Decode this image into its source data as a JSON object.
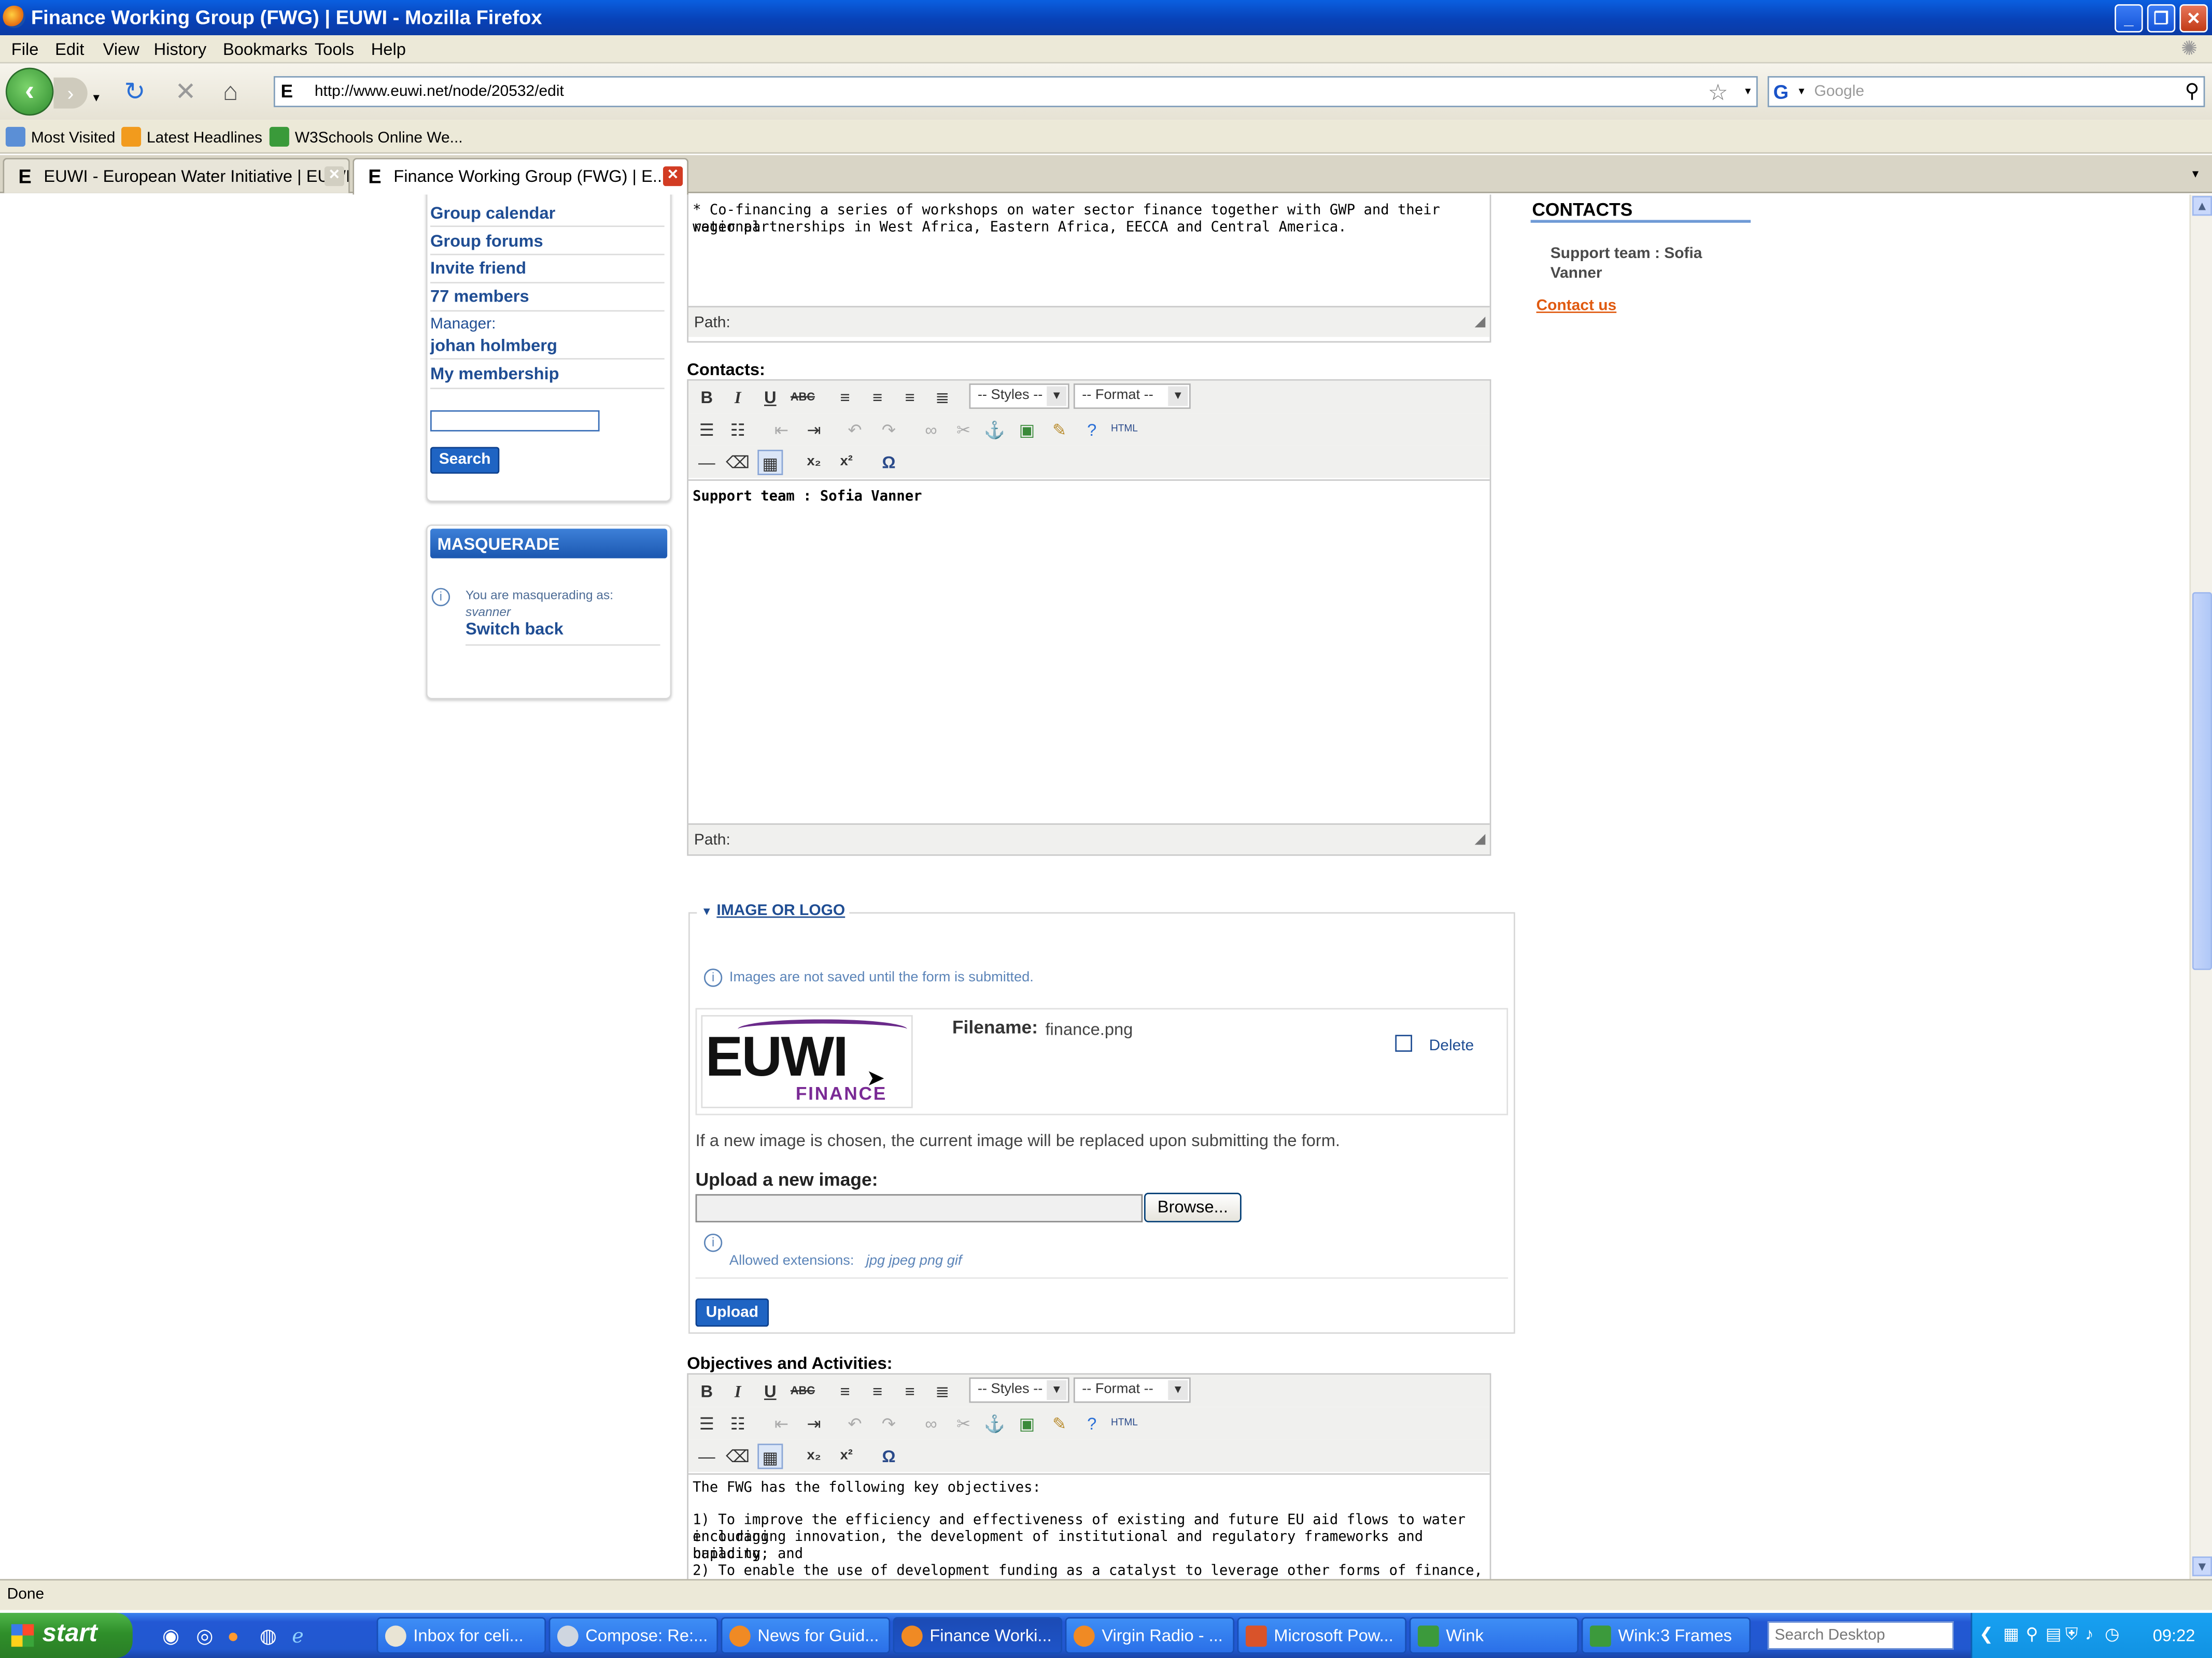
{
  "window": {
    "title": "Finance Working Group (FWG) | EUWI - Mozilla Firefox"
  },
  "menu": [
    "File",
    "Edit",
    "View",
    "History",
    "Bookmarks",
    "Tools",
    "Help"
  ],
  "nav": {
    "url": "http://www.euwi.net/node/20532/edit",
    "search_placeholder": "Google"
  },
  "bookmarks": [
    "Most Visited",
    "Latest Headlines",
    "W3Schools Online We..."
  ],
  "tabs": [
    "EUWI - European Water Initiative | EUWI",
    "Finance Working Group (FWG) | E..."
  ],
  "sidebar": {
    "links": [
      "Group calendar",
      "Group forums",
      "Invite friend",
      "77 members"
    ],
    "manager_label": "Manager:",
    "manager_name": "johan holmberg",
    "membership": "My membership",
    "search_button": "Search",
    "masquerade_title": "MASQUERADE",
    "masquerade_text": "You are masquerading as:",
    "masquerade_user": "svanner",
    "switch_back": "Switch back"
  },
  "right": {
    "heading": "CONTACTS",
    "support": "Support team : Sofia Vanner",
    "contact_us": "Contact us"
  },
  "editor1": {
    "line1": "* Co-financing a series of workshops on water sector finance together with GWP and their regional",
    "line2": "water partnerships in West Africa, Eastern Africa, EECCA and Central America.",
    "path": "Path:"
  },
  "contacts": {
    "label": "Contacts:",
    "styles": "-- Styles --",
    "format": "-- Format --",
    "body": "Support team : Sofia Vanner",
    "path": "Path:"
  },
  "image": {
    "legend": "IMAGE OR LOGO",
    "note": "Images are not saved until the form is submitted.",
    "logo_main": "EUWI",
    "logo_sub": "FINANCE",
    "filename_label": "Filename:",
    "filename": "finance.png",
    "delete": "Delete",
    "replace_note": "If a new image is chosen, the current image will be replaced upon submitting the form.",
    "upload_label": "Upload a new image:",
    "browse": "Browse...",
    "allowed_label": "Allowed extensions:",
    "allowed_ext": "jpg jpeg png gif",
    "upload_button": "Upload"
  },
  "objectives": {
    "label": "Objectives and Activities:",
    "styles": "-- Styles --",
    "format": "-- Format --",
    "line1": "The FWG has the following key objectives:",
    "line2": "1) To improve the efficiency and effectiveness of existing and future EU aid flows to water including",
    "line3": "encouraging innovation, the development of institutional and regulatory frameworks and capacity",
    "line4": "building; and",
    "line5": "2) To enable the use of development funding as a catalyst to leverage other forms of finance,"
  },
  "status": "Done",
  "taskbar": {
    "start": "start",
    "items": [
      "Inbox for celi...",
      "Compose: Re:...",
      "News for Guid...",
      "Finance Worki...",
      "Virgin Radio - ...",
      "Microsoft Pow...",
      "Wink",
      "Wink:3 Frames"
    ],
    "search_desktop": "Search Desktop",
    "clock": "09:22"
  }
}
